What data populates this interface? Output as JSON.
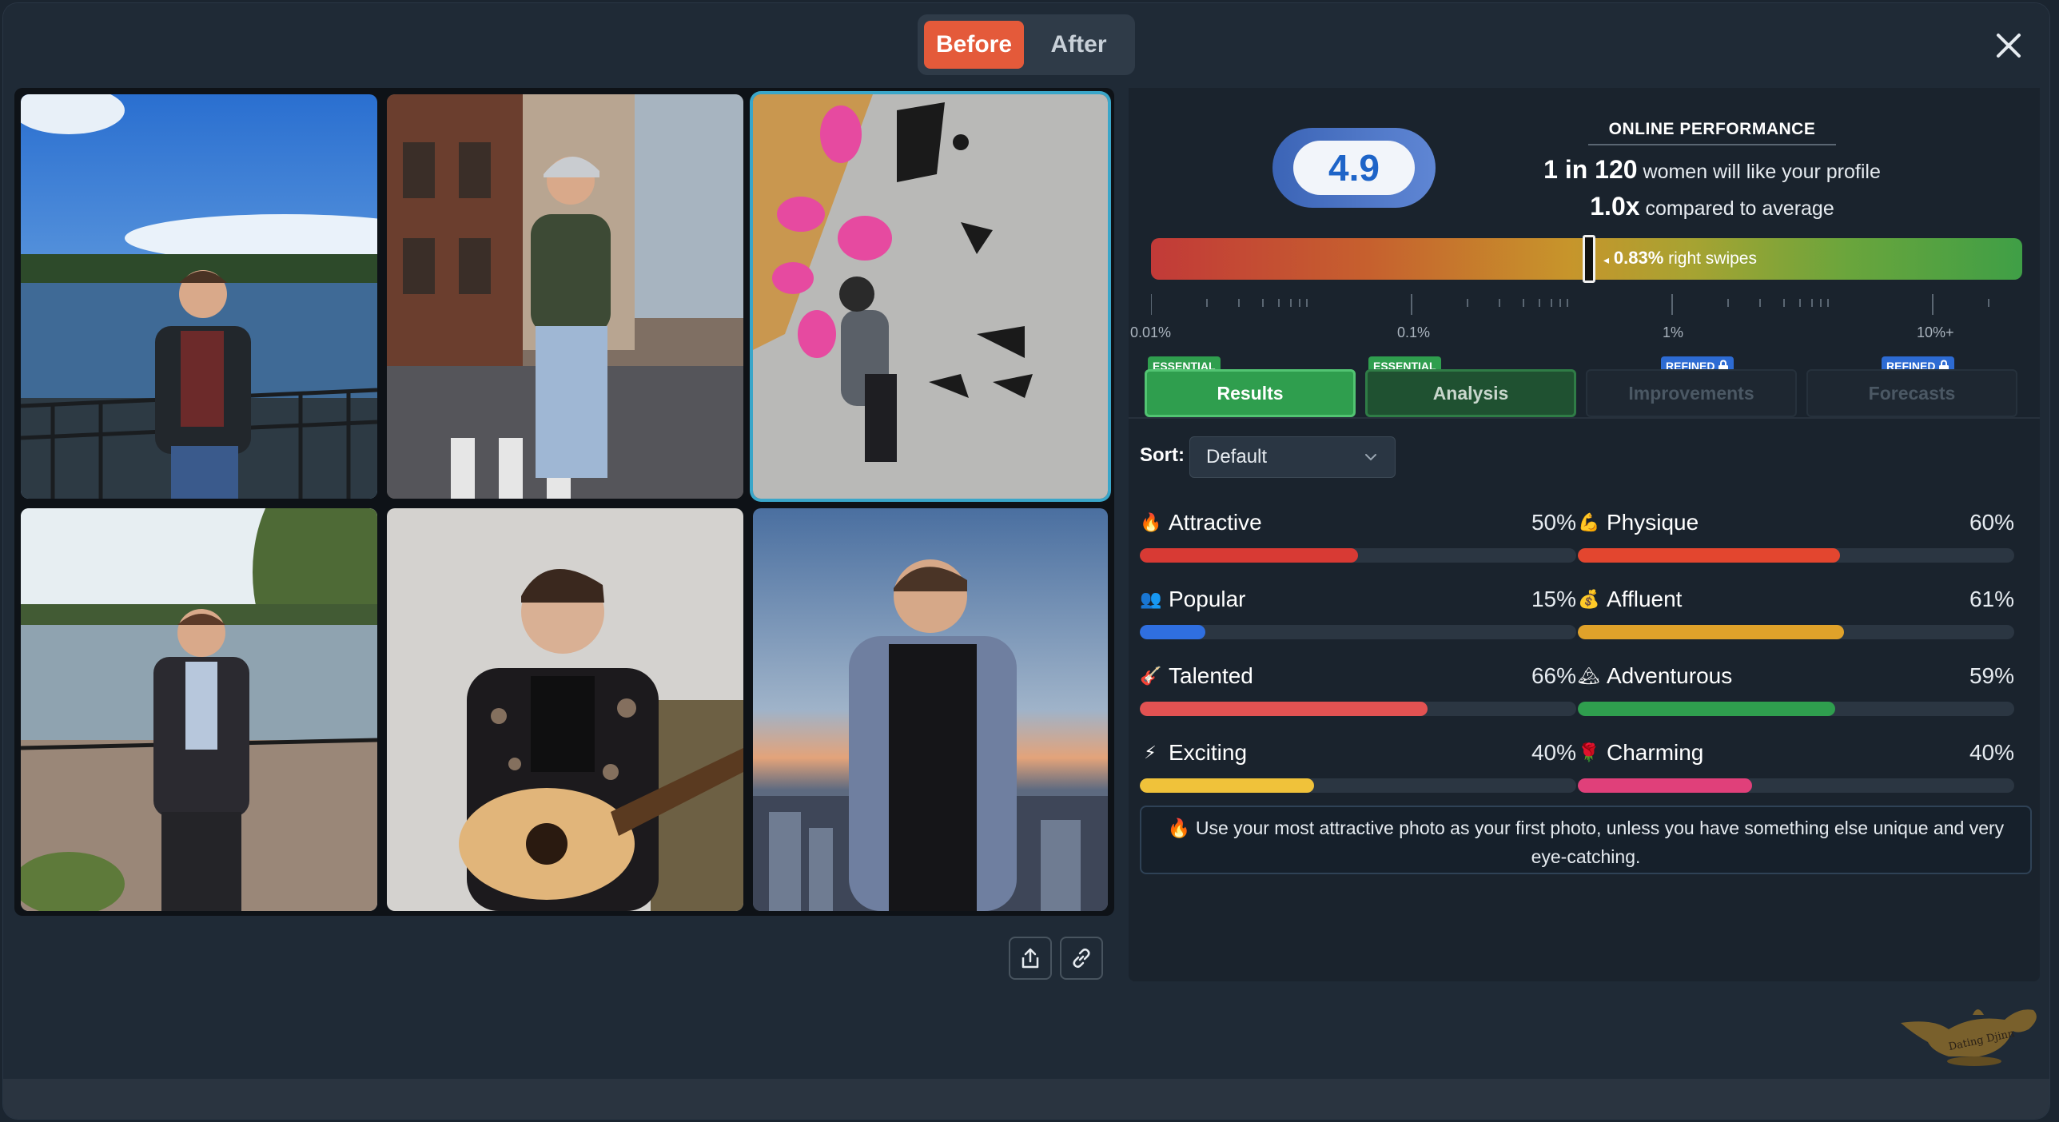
{
  "toggle": {
    "before": "Before",
    "after": "After"
  },
  "performance": {
    "score": "4.9",
    "title": "ONLINE PERFORMANCE",
    "line1_bold": "1 in 120",
    "line1_text": "women will like your profile",
    "line2_bold": "1.0x",
    "line2_text": "compared to average",
    "swipe_pct": "0.83%",
    "swipe_text": "right swipes",
    "scale_labels": [
      "0.01%",
      "0.1%",
      "1%",
      "10%+"
    ]
  },
  "tabs": [
    {
      "label": "Results",
      "badge": "ESSENTIAL"
    },
    {
      "label": "Analysis",
      "badge": "ESSENTIAL"
    },
    {
      "label": "Improvements",
      "badge": "REFINED"
    },
    {
      "label": "Forecasts",
      "badge": "REFINED"
    }
  ],
  "sort": {
    "label": "Sort:",
    "value": "Default"
  },
  "metrics": [
    {
      "name": "Attractive",
      "pct": "50%",
      "value": 50,
      "emoji": "🔥",
      "color": "#d83a34"
    },
    {
      "name": "Physique",
      "pct": "60%",
      "value": 60,
      "emoji": "💪",
      "color": "#e3462f"
    },
    {
      "name": "Popular",
      "pct": "15%",
      "value": 15,
      "emoji": "👥",
      "color": "#2f6fe0"
    },
    {
      "name": "Affluent",
      "pct": "61%",
      "value": 61,
      "emoji": "💰",
      "color": "#e0a22a"
    },
    {
      "name": "Talented",
      "pct": "66%",
      "value": 66,
      "emoji": "🎸",
      "color": "#e25252"
    },
    {
      "name": "Adventurous",
      "pct": "59%",
      "value": 59,
      "emoji": "🏔",
      "color": "#2f9e4e"
    },
    {
      "name": "Exciting",
      "pct": "40%",
      "value": 40,
      "emoji": "⚡",
      "color": "#f0c23a"
    },
    {
      "name": "Charming",
      "pct": "40%",
      "value": 40,
      "emoji": "🌹",
      "color": "#e0407a"
    }
  ],
  "tip": "🔥 Use your most attractive photo as your first photo, unless you have something else unique and very eye-catching.",
  "brand": "Dating Djinn",
  "icons": {
    "close": "close-icon",
    "share": "share-icon",
    "link": "link-icon",
    "lock": "lock-icon",
    "chevron": "chevron-down-icon"
  }
}
